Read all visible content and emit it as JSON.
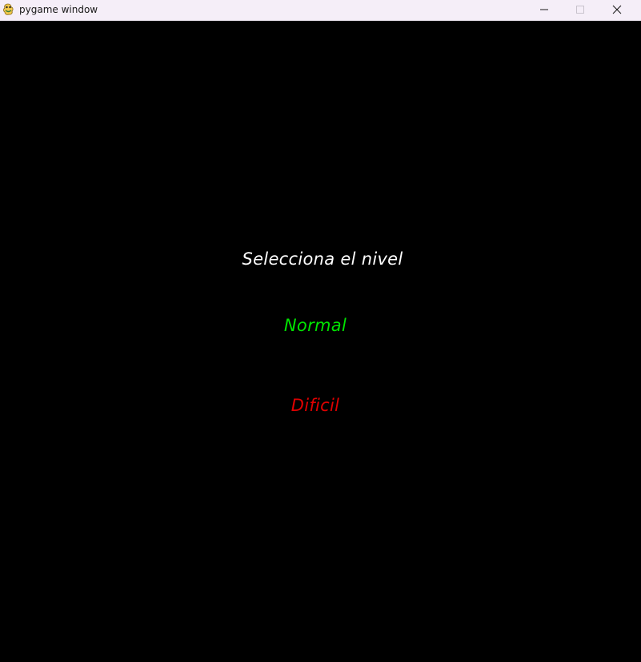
{
  "window": {
    "title": "pygame window",
    "icon": "pygame-snake-icon"
  },
  "controls": {
    "minimize_icon": "minimize-icon",
    "maximize_icon": "maximize-icon",
    "close_icon": "close-icon"
  },
  "menu": {
    "heading": "Selecciona el nivel",
    "options": [
      {
        "label": "Normal",
        "color": "#00e400"
      },
      {
        "label": "Dificil",
        "color": "#e00000"
      }
    ]
  },
  "colors": {
    "background": "#000000",
    "titlebar": "#f5eef8",
    "heading": "#ffffff"
  }
}
